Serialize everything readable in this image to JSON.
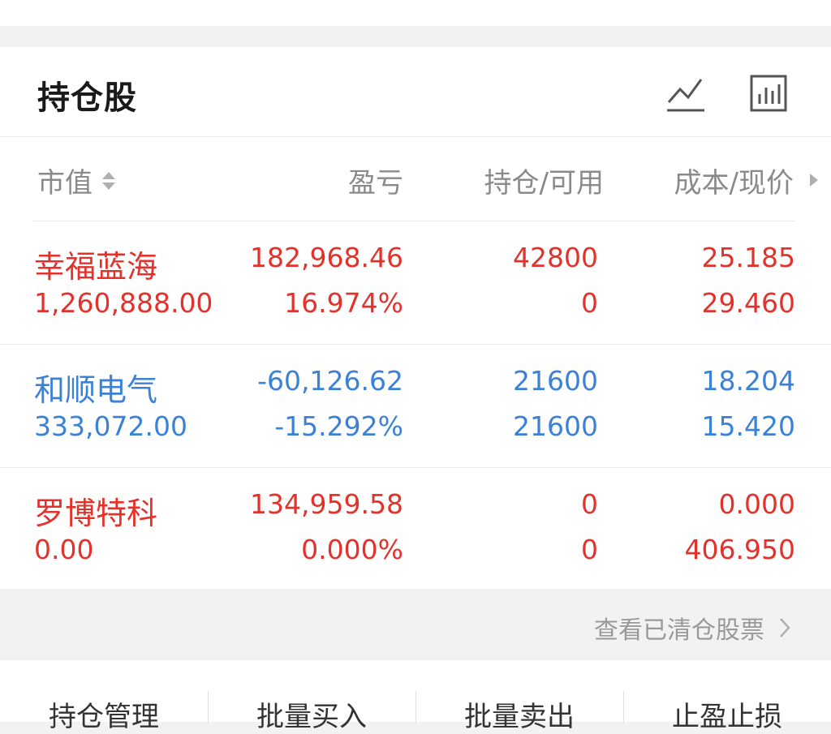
{
  "header": {
    "title": "持仓股"
  },
  "icons": {
    "trend": "trend-line-icon",
    "chart": "bar-chart-icon",
    "sort": "sort-icon",
    "more": "chevron-right-icon"
  },
  "colors": {
    "up": "#e3322b",
    "down": "#3b82d6",
    "muted": "#8a8a8a",
    "text": "#1a1a1a"
  },
  "columns": {
    "market_value": "市值",
    "pnl": "盈亏",
    "position": "持仓/可用",
    "cost_price": "成本/现价"
  },
  "holdings": [
    {
      "name": "幸福蓝海",
      "market_value": "1,260,888.00",
      "pnl": "182,968.46",
      "pnl_pct": "16.974%",
      "hold": "42800",
      "available": "0",
      "cost": "25.185",
      "price": "29.460",
      "trend": "up"
    },
    {
      "name": "和顺电气",
      "market_value": "333,072.00",
      "pnl": "-60,126.62",
      "pnl_pct": "-15.292%",
      "hold": "21600",
      "available": "21600",
      "cost": "18.204",
      "price": "15.420",
      "trend": "down"
    },
    {
      "name": "罗博特科",
      "market_value": "0.00",
      "pnl": "134,959.58",
      "pnl_pct": "0.000%",
      "hold": "0",
      "available": "0",
      "cost": "0.000",
      "price": "406.950",
      "trend": "up"
    }
  ],
  "cleared_link": "查看已清仓股票",
  "bottom_tabs": [
    "持仓管理",
    "批量买入",
    "批量卖出",
    "止盈止损"
  ]
}
